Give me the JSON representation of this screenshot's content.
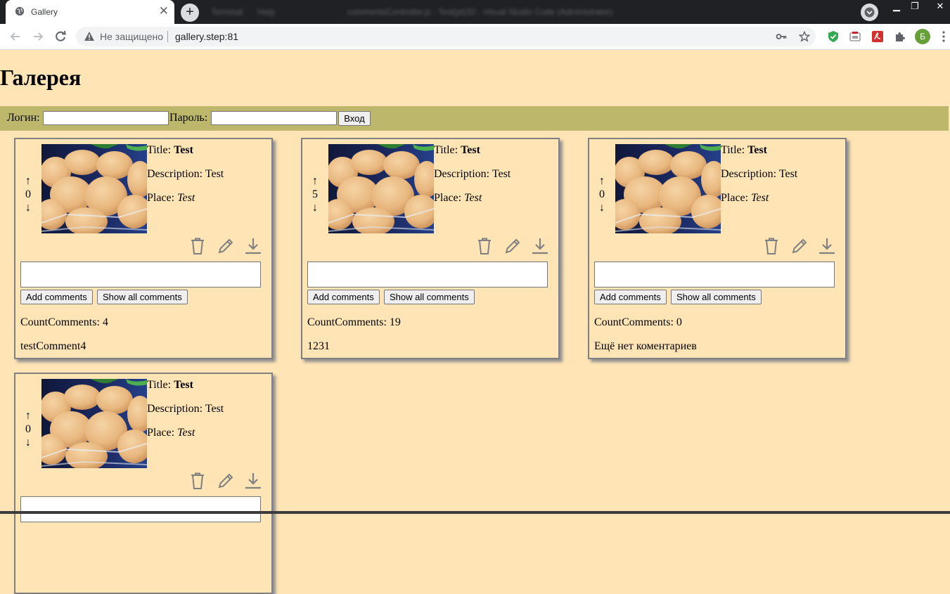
{
  "browser": {
    "tab_title": "Gallery",
    "tab_close": "✕",
    "new_tab": "+",
    "blurred_items": [
      "Terminal",
      "Help",
      "commentsController.js - Test(pt)32 - Visual Studio Code (Administrator)"
    ],
    "address": {
      "security_label": "Не защищено",
      "url": "gallery.step:81"
    },
    "profile_initial": "Б",
    "window_controls": [
      "▁",
      "❐",
      "✕"
    ]
  },
  "page": {
    "title": "Галерея"
  },
  "login": {
    "login_label": "Логин:",
    "password_label": "Пароль:",
    "login_value": "",
    "password_value": "",
    "submit_label": "Вход"
  },
  "labels": {
    "up_arrow": "↑",
    "down_arrow": "↓",
    "title_prefix": "Title:",
    "description_prefix": "Description:",
    "place_prefix": "Place:",
    "add_comments": "Add comments",
    "show_all_comments": "Show all comments",
    "count_prefix": "CountComments:"
  },
  "cards": [
    {
      "votes": "0",
      "title": "Test",
      "description": "Test",
      "place": "Test",
      "comment_input": "",
      "count": "4",
      "last_comment": "testComment4"
    },
    {
      "votes": "5",
      "title": "Test",
      "description": "Test",
      "place": "Test",
      "comment_input": "",
      "count": "19",
      "last_comment": "1231"
    },
    {
      "votes": "0",
      "title": "Test",
      "description": "Test",
      "place": "Test",
      "comment_input": "",
      "count": "0",
      "last_comment": "Ещё нет коментариев"
    },
    {
      "votes": "0",
      "title": "Test",
      "description": "Test",
      "place": "Test",
      "comment_input": ""
    }
  ],
  "colors": {
    "page_background": "#ffe4b5",
    "login_bar": "#bdb76b",
    "card_border": "#808080",
    "icon_gray": "#808080"
  }
}
